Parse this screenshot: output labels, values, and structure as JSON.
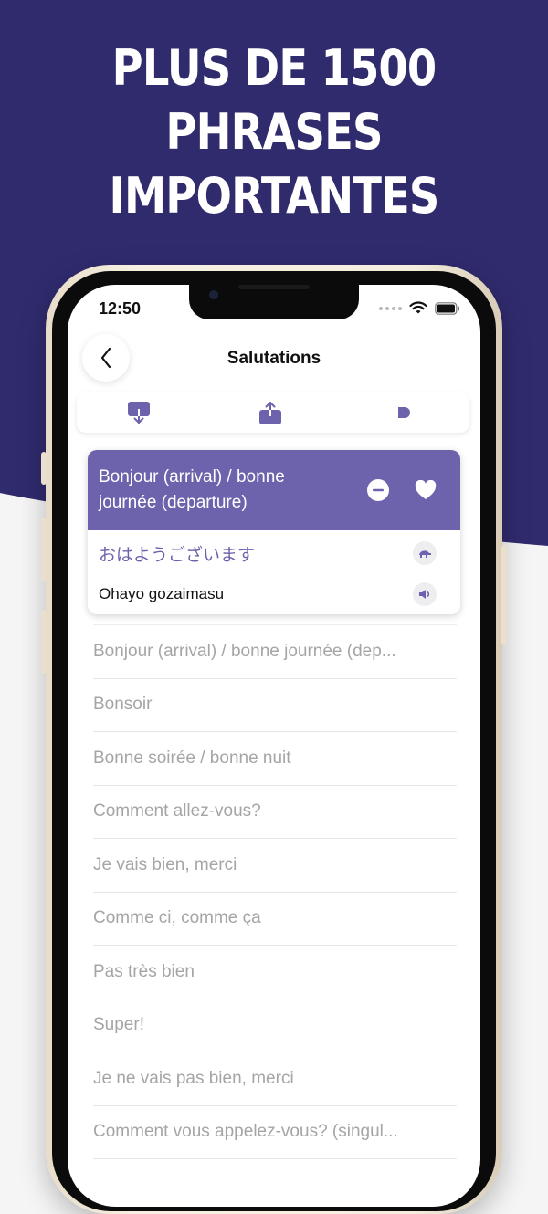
{
  "headline": [
    "PLUS DE 1500",
    "PHRASES",
    "IMPORTANTES"
  ],
  "status_bar": {
    "time": "12:50"
  },
  "nav": {
    "title": "Salutations"
  },
  "colors": {
    "brand_dark": "#302b6d",
    "accent": "#6d63ad"
  },
  "toolbar": {
    "items": [
      {
        "icon": "download-icon"
      },
      {
        "icon": "share-icon"
      },
      {
        "icon": "play-icon"
      }
    ]
  },
  "selected_card": {
    "phrase": "Bonjour (arrival) / bonne journée (departure)",
    "translation": "おはようございます",
    "romanization": "Ohayo gozaimasu"
  },
  "phrases": [
    "Bonjour (arrival) / bonne journée (dep...",
    "Bonsoir",
    "Bonne soirée / bonne nuit",
    "Comment allez-vous?",
    "Je vais bien, merci",
    "Comme ci, comme ça",
    "Pas très bien",
    "Super!",
    "Je ne vais pas bien, merci",
    "Comment vous appelez-vous? (singul..."
  ]
}
